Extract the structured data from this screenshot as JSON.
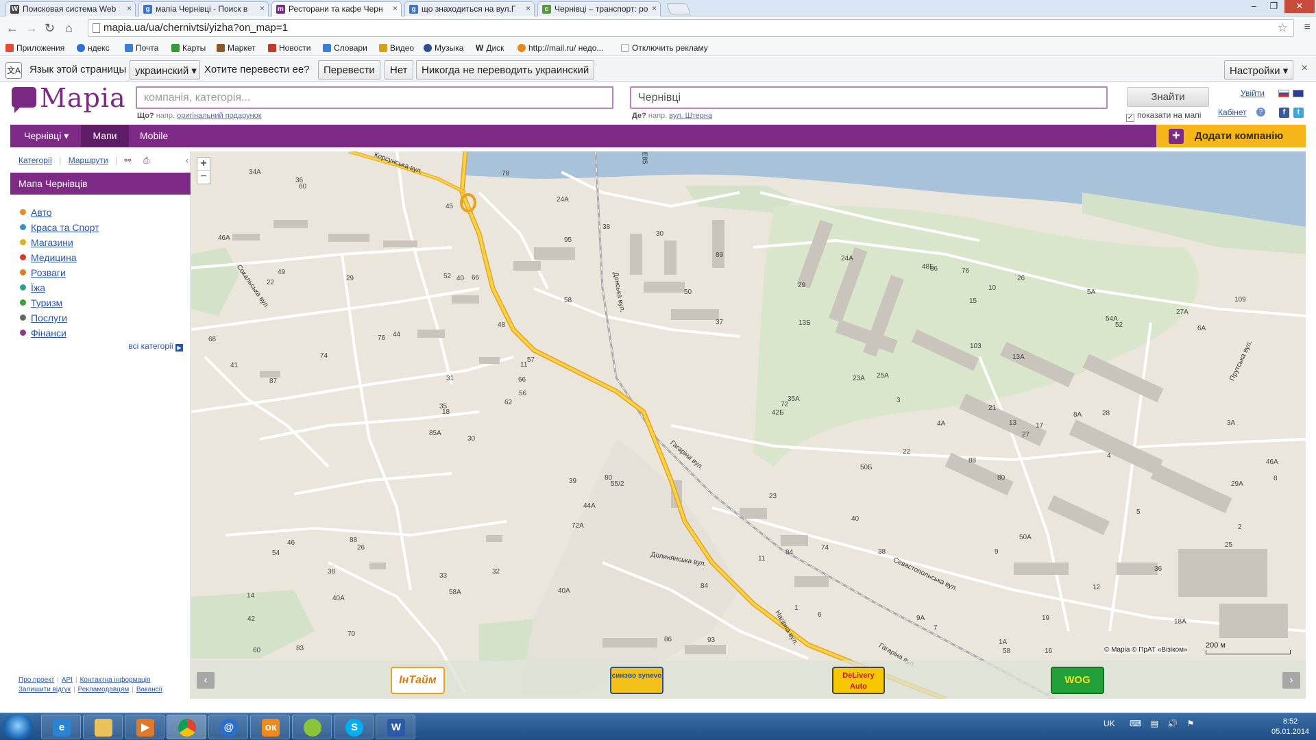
{
  "browser": {
    "tabs": [
      {
        "label": "Поисковая система Web",
        "icon": "W",
        "icon_color": "#444444"
      },
      {
        "label": "мапіа Чернівці - Поиск в",
        "icon": "g",
        "icon_color": "#3b74c9"
      },
      {
        "label": "Ресторани та кафе Черн",
        "icon": "m",
        "icon_color": "#7b2a83"
      },
      {
        "label": "що знаходиться на вул.Г",
        "icon": "g",
        "icon_color": "#3b74c9"
      },
      {
        "label": "Чернівці – транспорт: ро",
        "icon": "c",
        "icon_color": "#5a9a3a"
      }
    ],
    "url": "mapia.ua/ua/chernivtsi/yizha?on_map=1",
    "bookmarks": [
      {
        "label": "Приложения",
        "icon_color": "#e04e39"
      },
      {
        "label": "ндекс",
        "icon_color": "#2f6fcf"
      },
      {
        "label": "Почта",
        "icon_color": "#3a7fd5"
      },
      {
        "label": "Карты",
        "icon_color": "#3a9a3a"
      },
      {
        "label": "Маркет",
        "icon_color": "#8a5a2a"
      },
      {
        "label": "Новости",
        "icon_color": "#c0392b"
      },
      {
        "label": "Словари",
        "icon_color": "#3a7fd5"
      },
      {
        "label": "Видео",
        "icon_color": "#d4a21a"
      },
      {
        "label": "Музыка",
        "icon_color": "#2f4f8f"
      },
      {
        "label": "Диск",
        "icon_color": "#333333",
        "prefix": "W"
      },
      {
        "label": "http://mail.ru/ недо...",
        "icon_color": "#e08a1a"
      },
      {
        "label": "Отключить рекламу",
        "icon_color": "#ffffff"
      }
    ]
  },
  "translate_bar": {
    "prompt": "Язык этой страницы",
    "language": "украинский",
    "question": "Хотите перевести ее?",
    "translate_btn": "Перевести",
    "no_btn": "Нет",
    "never_btn": "Никогда не переводить украинский",
    "settings_btn": "Настройки"
  },
  "site": {
    "logo": "Mapia",
    "what_placeholder": "компанія, категорія...",
    "what_hint_label": "Що?",
    "what_hint_text": "напр.",
    "what_hint_example": "оригінальний подарунок",
    "where_value": "Чернівці",
    "where_hint_label": "Де?",
    "where_hint_text": "напр.",
    "where_hint_example": "вул. Штерна",
    "find_btn": "Знайти",
    "show_on_map": "показати на мапі",
    "login": "Увійти",
    "cabinet": "Кабінет"
  },
  "nav": {
    "city": "Чернівці ▾",
    "maps": "Мапи",
    "mobile": "Mobile",
    "add_company": "Додати компанію"
  },
  "sidebar": {
    "tab_categories": "Категорії",
    "tab_routes": "Маршрути",
    "title": "Мапа Чернівців",
    "categories": [
      {
        "label": "Авто",
        "color": "#e58b2a"
      },
      {
        "label": "Краса та Спорт",
        "color": "#3a8fd0"
      },
      {
        "label": "Магазини",
        "color": "#e0b21a"
      },
      {
        "label": "Медицина",
        "color": "#d63a2a"
      },
      {
        "label": "Розваги",
        "color": "#e07a1a"
      },
      {
        "label": "Їжа",
        "color": "#2aa08a"
      },
      {
        "label": "Туризм",
        "color": "#3aa03a"
      },
      {
        "label": "Послуги",
        "color": "#666666"
      },
      {
        "label": "Фінанси",
        "color": "#8a3a8a"
      }
    ],
    "all_categories": "всі категорії",
    "footer_links_row1": [
      "Про проект",
      "API",
      "Контактна інформація"
    ],
    "footer_links_row2": [
      "Залишити відгук",
      "Рекламодавцям",
      "Вакансії"
    ]
  },
  "map": {
    "scale_label": "200 м",
    "copyright": "© Mapia © ПрАТ «Візіком»",
    "streets": [
      {
        "label": "Корсунська вул."
      },
      {
        "label": "Сокальська вул."
      },
      {
        "label": "Гагаріна вул."
      },
      {
        "label": "Гагаріна вул. "
      },
      {
        "label": "Донська вул."
      },
      {
        "label": "Севастопольська вул."
      },
      {
        "label": "Долинянська вул."
      },
      {
        "label": "Прутська вул."
      },
      {
        "label": "Нагірна вул."
      },
      {
        "label": "E85"
      }
    ],
    "house_numbers": [
      "30",
      "22",
      "18",
      "14",
      "11",
      "26",
      "24A",
      "66",
      "95",
      "62",
      "60",
      "93",
      "87",
      "89",
      "85A",
      "58",
      "83",
      "52",
      "48",
      "46",
      "44",
      "42",
      "40A",
      "40",
      "57",
      "55/2",
      "49",
      "45",
      "41",
      "39",
      "37",
      "35",
      "33",
      "31",
      "29",
      "38",
      "88",
      "86",
      "84",
      "80",
      "78",
      "76",
      "74",
      "72A",
      "70",
      "68",
      "66",
      "60",
      "58A",
      "56",
      "54",
      "50",
      "46A",
      "44A",
      "40A",
      "38",
      "36",
      "34A",
      "32",
      "30",
      "26",
      "22",
      "35A",
      "25A",
      "27A",
      "24A",
      "5A",
      "15",
      "13",
      "11",
      "9",
      "7",
      "5",
      "3",
      "1",
      "29",
      "23A",
      "23",
      "21",
      "19",
      "17",
      "6",
      "4",
      "2",
      "1A",
      "3A",
      "50A",
      "18A",
      "16",
      "12",
      "10",
      "8",
      "28",
      "36",
      "27",
      "25",
      "72",
      "58",
      "54A",
      "52",
      "50Б",
      "48Б",
      "46A",
      "42Б",
      "40",
      "38",
      "9A",
      "8A",
      "6A",
      "4A",
      "29A",
      "13Б",
      "13A",
      "88",
      "86",
      "84",
      "80",
      "109",
      "103",
      "76",
      "74"
    ],
    "ad_logos": [
      "ІнТайм",
      "синэво synevo",
      "DeLivery Auto",
      "WOG"
    ]
  },
  "taskbar": {
    "lang": "UK",
    "time": "8:52",
    "date": "05.01.2014"
  }
}
